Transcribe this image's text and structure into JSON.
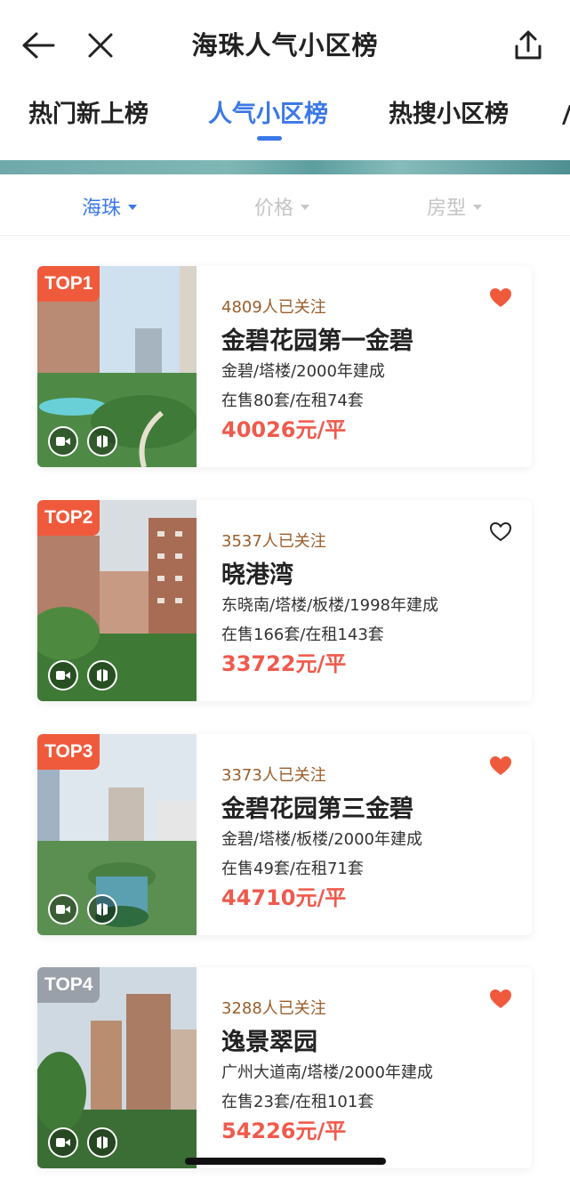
{
  "header": {
    "title": "海珠人气小区榜"
  },
  "tabs": [
    {
      "label": "热门新上榜"
    },
    {
      "label": "人气小区榜"
    },
    {
      "label": "热搜小区榜"
    }
  ],
  "filters": [
    {
      "label": "海珠"
    },
    {
      "label": "价格"
    },
    {
      "label": "房型"
    }
  ],
  "listings": [
    {
      "rank": "TOP1",
      "followers": "4809人已关注",
      "name": "金碧花园第一金碧",
      "desc": "金碧/塔楼/2000年建成",
      "stock": "在售80套/在租74套",
      "price": "40026元/平",
      "favorited": true
    },
    {
      "rank": "TOP2",
      "followers": "3537人已关注",
      "name": "晓港湾",
      "desc": "东晓南/塔楼/板楼/1998年建成",
      "stock": "在售166套/在租143套",
      "price": "33722元/平",
      "favorited": false
    },
    {
      "rank": "TOP3",
      "followers": "3373人已关注",
      "name": "金碧花园第三金碧",
      "desc": "金碧/塔楼/板楼/2000年建成",
      "stock": "在售49套/在租71套",
      "price": "44710元/平",
      "favorited": true
    },
    {
      "rank": "TOP4",
      "followers": "3288人已关注",
      "name": "逸景翠园",
      "desc": "广州大道南/塔楼/2000年建成",
      "stock": "在售23套/在租101套",
      "price": "54226元/平",
      "favorited": true
    }
  ],
  "colors": {
    "accent": "#3b78e7",
    "price": "#ef5a4c",
    "followers": "#9b5d2a",
    "rank_top3": "#f05a3c",
    "rank_other": "#9aa0aa",
    "heart_filled": "#f05a3c"
  }
}
